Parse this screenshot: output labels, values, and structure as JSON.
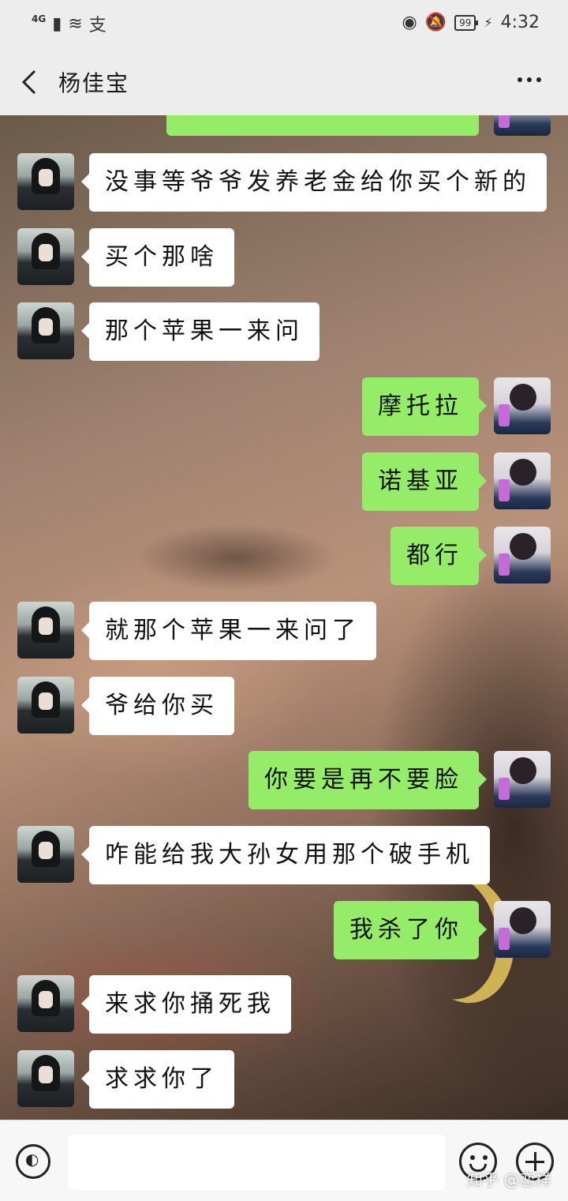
{
  "status_bar": {
    "network": "4G",
    "signal_icon": "signal-bars-icon",
    "wifi_icon": "wifi-icon",
    "pay_icon": "alipay-icon",
    "eye_icon": "eye-icon",
    "mute_icon": "bell-off-icon",
    "battery": "99",
    "time": "4:32"
  },
  "header": {
    "title": "杨佳宝",
    "back_icon": "chevron-left-icon",
    "more_icon": "more-icon"
  },
  "messages": [
    {
      "side": "right",
      "text": "",
      "partial": true
    },
    {
      "side": "left",
      "text": "没事等爷爷发养老金给你买个新的"
    },
    {
      "side": "left",
      "text": "买个那啥"
    },
    {
      "side": "left",
      "text": "那个苹果一来问"
    },
    {
      "side": "right",
      "text": "摩托拉"
    },
    {
      "side": "right",
      "text": "诺基亚"
    },
    {
      "side": "right",
      "text": "都行"
    },
    {
      "side": "left",
      "text": "就那个苹果一来问了"
    },
    {
      "side": "left",
      "text": "爷给你买"
    },
    {
      "side": "right",
      "text": "你要是再不要脸"
    },
    {
      "side": "left",
      "text": "咋能给我大孙女用那个破手机"
    },
    {
      "side": "right",
      "text": "我杀了你"
    },
    {
      "side": "left",
      "text": "来求你捅死我"
    },
    {
      "side": "left",
      "text": "求求你了"
    }
  ],
  "input_bar": {
    "voice_icon": "voice-icon",
    "emoji_icon": "emoji-icon",
    "plus_icon": "plus-icon"
  },
  "watermark": "知乎 @恋祥"
}
